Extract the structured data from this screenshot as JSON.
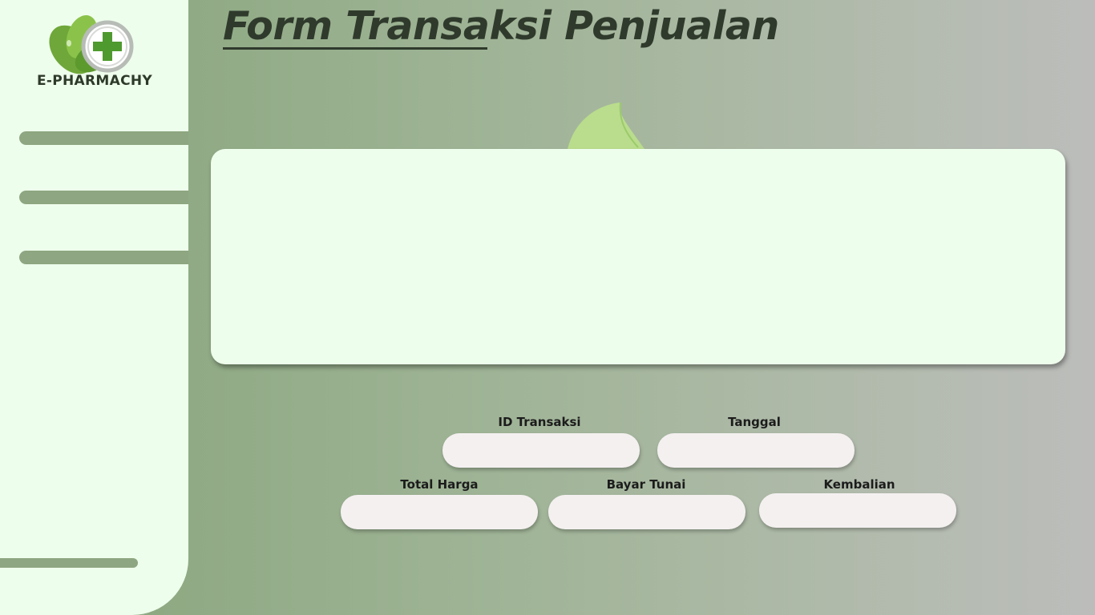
{
  "app": {
    "brand": "E-PHARMACHY",
    "accent_color": "#8ea681",
    "panel_color": "#eefeec"
  },
  "header": {
    "title": "Form Transaksi Penjualan"
  },
  "form": {
    "id_transaksi": {
      "label": "ID Transaksi",
      "value": ""
    },
    "tanggal": {
      "label": "Tanggal",
      "value": ""
    },
    "total_harga": {
      "label": "Total Harga",
      "value": ""
    },
    "bayar_tunai": {
      "label": "Bayar Tunai",
      "value": ""
    },
    "kembalian": {
      "label": "Kembalian",
      "value": ""
    }
  }
}
